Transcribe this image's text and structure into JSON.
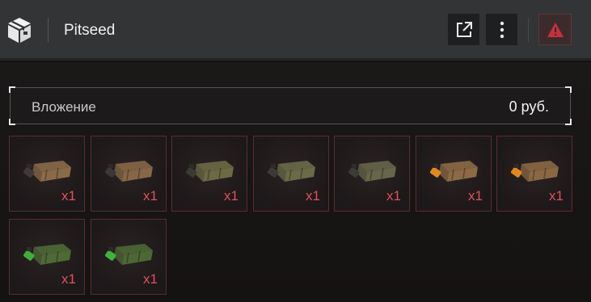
{
  "header": {
    "title": "Pitseed",
    "icons": {
      "logo": "cube-box-icon",
      "open": "external-link-icon",
      "menu": "vertical-dots-icon",
      "warn": "warning-triangle-icon"
    }
  },
  "summary": {
    "label": "Вложение",
    "value": "0 руб."
  },
  "items": [
    {
      "quantity": "x1",
      "variant": "brown",
      "body": "#8a6a48",
      "tip": "#3d3a38"
    },
    {
      "quantity": "x1",
      "variant": "brown",
      "body": "#876747",
      "tip": "#3b3837"
    },
    {
      "quantity": "x1",
      "variant": "olive",
      "body": "#6b6a44",
      "tip": "#3a3b33"
    },
    {
      "quantity": "x1",
      "variant": "olive",
      "body": "#6a6b48",
      "tip": "#3b3c36"
    },
    {
      "quantity": "x1",
      "variant": "olive",
      "body": "#66664a",
      "tip": "#3b3b38"
    },
    {
      "quantity": "x1",
      "variant": "orange",
      "body": "#8c6a45",
      "tip": "#e08a1e"
    },
    {
      "quantity": "x1",
      "variant": "orange",
      "body": "#8a6844",
      "tip": "#e3871c"
    },
    {
      "quantity": "x1",
      "variant": "green",
      "body": "#4e6a36",
      "tip": "#3fae3a"
    },
    {
      "quantity": "x1",
      "variant": "green",
      "body": "#4d6835",
      "tip": "#41b23c"
    }
  ]
}
